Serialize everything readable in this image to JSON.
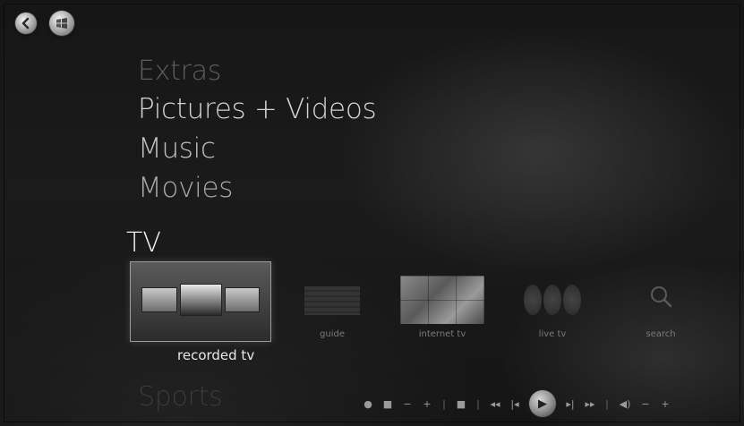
{
  "nav": {
    "back_icon": "back-arrow-icon",
    "start_icon": "windows-logo-icon"
  },
  "menu": {
    "items": [
      {
        "label": "Extras"
      },
      {
        "label": "Pictures + Videos"
      },
      {
        "label": "Music"
      },
      {
        "label": "Movies"
      },
      {
        "label": "Sports"
      }
    ]
  },
  "tv": {
    "heading": "TV",
    "tiles": [
      {
        "label": "recorded tv",
        "selected": true
      },
      {
        "label": "guide"
      },
      {
        "label": "internet tv"
      },
      {
        "label": "live tv"
      },
      {
        "label": "search",
        "icon": "search-icon"
      }
    ]
  },
  "transport": {
    "buttons": [
      {
        "name": "record-button",
        "symbol": "●"
      },
      {
        "name": "guide-button",
        "symbol": "■"
      },
      {
        "name": "channel-down-button",
        "symbol": "−"
      },
      {
        "name": "channel-up-button",
        "symbol": "+"
      },
      {
        "name": "separator",
        "symbol": "|"
      },
      {
        "name": "stop-button",
        "symbol": "■"
      },
      {
        "name": "separator",
        "symbol": "|"
      },
      {
        "name": "rewind-button",
        "symbol": "◂◂"
      },
      {
        "name": "skip-back-button",
        "symbol": "|◂"
      },
      {
        "name": "play-button",
        "symbol": "▶"
      },
      {
        "name": "skip-forward-button",
        "symbol": "▸|"
      },
      {
        "name": "fast-forward-button",
        "symbol": "▸▸"
      },
      {
        "name": "separator",
        "symbol": "|"
      },
      {
        "name": "mute-button",
        "symbol": "◀)"
      },
      {
        "name": "volume-down-button",
        "symbol": "−"
      },
      {
        "name": "volume-up-button",
        "symbol": "+"
      }
    ]
  },
  "colors": {
    "background": "#181818",
    "text": "#d4d4d4"
  }
}
